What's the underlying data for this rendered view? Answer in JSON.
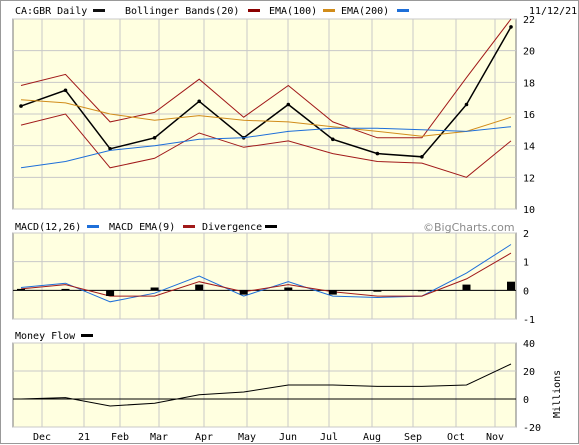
{
  "header": {
    "symbol_label": "CA:GBR Daily",
    "date": "11/12/21",
    "legend": [
      {
        "label": "Bollinger Bands(20)",
        "color": "#111111"
      },
      {
        "label": "EMA(100)",
        "color": "#8b0000"
      },
      {
        "label": "EMA(200)",
        "color": "#d18c1a"
      },
      {
        "label": "",
        "color": "#1e6fd9"
      }
    ]
  },
  "macd_header": {
    "legend": [
      {
        "label": "MACD(12,26)",
        "color": "#1e6fd9"
      },
      {
        "label": "MACD EMA(9)",
        "color": "#a11a1a"
      },
      {
        "label": "Divergence",
        "color": "#000000"
      }
    ]
  },
  "source": "©BigCharts.com",
  "mf_header": {
    "label": "Money Flow",
    "color": "#000000"
  },
  "months": [
    "Dec",
    "21",
    "Feb",
    "Mar",
    "Apr",
    "May",
    "Jun",
    "Jul",
    "Aug",
    "Sep",
    "Oct",
    "Nov"
  ],
  "colors": {
    "plot_bg": "#ffffe0",
    "grid": "#c8c8c8",
    "price": "#000000",
    "bollinger": "#a11a1a",
    "ema100": "#d18c1a",
    "ema200": "#1e6fd9",
    "macd": "#1e6fd9",
    "signal": "#a11a1a",
    "divergence": "#000000",
    "moneyflow": "#000000"
  },
  "chart_data": [
    {
      "type": "line",
      "title": "CA:GBR Daily",
      "ylim": [
        10,
        22
      ],
      "yticks": [
        10,
        12,
        14,
        16,
        18,
        20,
        22
      ],
      "x": [
        0,
        1,
        2,
        3,
        4,
        5,
        6,
        7,
        8,
        9,
        10,
        11
      ],
      "x_labels": [
        "Dec",
        "21",
        "Feb",
        "Mar",
        "Apr",
        "May",
        "Jun",
        "Jul",
        "Aug",
        "Sep",
        "Oct",
        "Nov"
      ],
      "series": [
        {
          "name": "Price",
          "values": [
            16.5,
            17.5,
            13.8,
            14.5,
            16.8,
            14.5,
            16.6,
            14.4,
            13.5,
            13.3,
            16.6,
            21.5
          ]
        },
        {
          "name": "Bollinger Upper",
          "values": [
            17.8,
            18.5,
            15.5,
            16.1,
            18.2,
            15.8,
            17.8,
            15.5,
            14.5,
            14.5,
            18.3,
            22.0
          ]
        },
        {
          "name": "Bollinger Lower",
          "values": [
            15.3,
            16.0,
            12.6,
            13.2,
            14.8,
            13.9,
            14.3,
            13.5,
            13.0,
            12.9,
            12.0,
            14.3
          ]
        },
        {
          "name": "EMA(100)",
          "values": [
            16.9,
            16.7,
            16.0,
            15.6,
            15.9,
            15.6,
            15.5,
            15.2,
            14.9,
            14.6,
            14.9,
            15.8
          ]
        },
        {
          "name": "EMA(200)",
          "values": [
            12.6,
            13.0,
            13.7,
            14.0,
            14.4,
            14.5,
            14.9,
            15.1,
            15.1,
            15.0,
            14.9,
            15.2
          ]
        }
      ]
    },
    {
      "type": "line",
      "title": "MACD(12,26)",
      "ylim": [
        -1,
        2
      ],
      "yticks": [
        -1,
        0,
        1,
        2
      ],
      "x": [
        0,
        1,
        2,
        3,
        4,
        5,
        6,
        7,
        8,
        9,
        10,
        11
      ],
      "series": [
        {
          "name": "MACD(12,26)",
          "values": [
            0.1,
            0.25,
            -0.4,
            -0.1,
            0.5,
            -0.2,
            0.3,
            -0.2,
            -0.25,
            -0.2,
            0.6,
            1.6
          ]
        },
        {
          "name": "MACD EMA(9)",
          "values": [
            0.05,
            0.2,
            -0.2,
            -0.2,
            0.3,
            -0.05,
            0.2,
            -0.05,
            -0.2,
            -0.2,
            0.4,
            1.3
          ]
        },
        {
          "name": "Divergence",
          "values": [
            0.05,
            0.05,
            -0.2,
            0.1,
            0.2,
            -0.15,
            0.1,
            -0.15,
            -0.05,
            0.0,
            0.2,
            0.3
          ]
        }
      ]
    },
    {
      "type": "line",
      "title": "Money Flow",
      "ylabel": "Millions",
      "ylim": [
        -20,
        40
      ],
      "yticks": [
        -20,
        0,
        20,
        40
      ],
      "x": [
        0,
        1,
        2,
        3,
        4,
        5,
        6,
        7,
        8,
        9,
        10,
        11
      ],
      "series": [
        {
          "name": "Money Flow",
          "values": [
            0,
            1,
            -5,
            -3,
            3,
            5,
            10,
            10,
            9,
            9,
            10,
            25
          ]
        }
      ]
    }
  ]
}
